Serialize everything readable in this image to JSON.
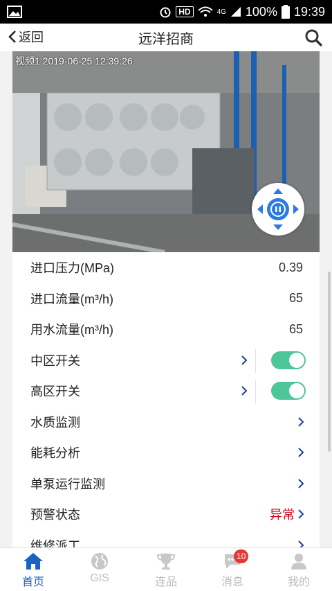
{
  "status_bar": {
    "hd": "HD",
    "network": "4G",
    "battery": "100%",
    "time": "19:39"
  },
  "header": {
    "back_label": "返回",
    "title": "远洋招商"
  },
  "video": {
    "caption": "视频1 2019-06-25 12:39:26"
  },
  "rows": [
    {
      "label": "进口压力(MPa)",
      "value": "0.39"
    },
    {
      "label": "进口流量(m³/h)",
      "value": "65"
    },
    {
      "label": "用水流量(m³/h)",
      "value": "65"
    },
    {
      "label": "中区开关",
      "toggle": true
    },
    {
      "label": "高区开关",
      "toggle": true
    },
    {
      "label": "水质监测"
    },
    {
      "label": "能耗分析"
    },
    {
      "label": "单泵运行监测"
    },
    {
      "label": "预警状态",
      "status": "异常"
    },
    {
      "label": "维修派工"
    }
  ],
  "tabs": [
    {
      "label": "首页",
      "icon": "home-icon"
    },
    {
      "label": "GIS",
      "icon": "globe-icon"
    },
    {
      "label": "连品",
      "icon": "trophy-icon"
    },
    {
      "label": "消息",
      "icon": "chat-icon",
      "badge": "10"
    },
    {
      "label": "我的",
      "icon": "user-icon"
    }
  ],
  "colors": {
    "accent": "#1a63c4",
    "toggle_on": "#4dc69b",
    "warning": "#d0021b",
    "chevron": "#1a3c9c"
  }
}
